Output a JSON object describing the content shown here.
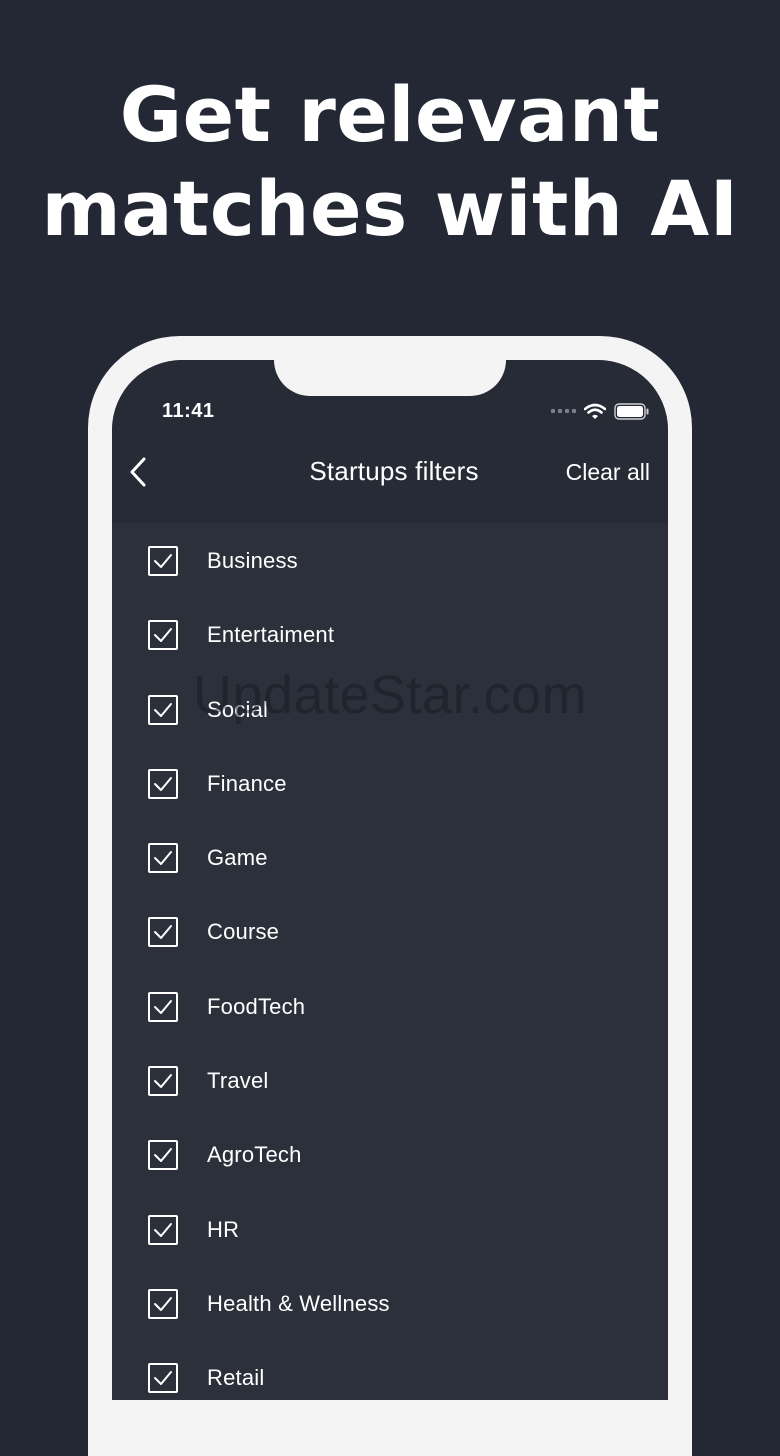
{
  "headline": {
    "line1": "Get relevant",
    "line2": "matches with AI"
  },
  "status_bar": {
    "time": "11:41"
  },
  "nav": {
    "title": "Startups filters",
    "clear_all": "Clear all"
  },
  "filters": [
    {
      "label": "Business",
      "checked": true
    },
    {
      "label": "Entertaiment",
      "checked": true
    },
    {
      "label": "Social",
      "checked": true
    },
    {
      "label": "Finance",
      "checked": true
    },
    {
      "label": "Game",
      "checked": true
    },
    {
      "label": "Course",
      "checked": true
    },
    {
      "label": "FoodTech",
      "checked": true
    },
    {
      "label": "Travel",
      "checked": true
    },
    {
      "label": "AgroTech",
      "checked": true
    },
    {
      "label": "HR",
      "checked": true
    },
    {
      "label": "Health & Wellness",
      "checked": true
    },
    {
      "label": "Retail",
      "checked": true
    }
  ],
  "watermark": "UpdateStar.com",
  "colors": {
    "background": "#232834",
    "screen": "#2b303b",
    "nav_bar": "#272b36",
    "frame": "#f4f4f4",
    "text": "#ffffff"
  }
}
